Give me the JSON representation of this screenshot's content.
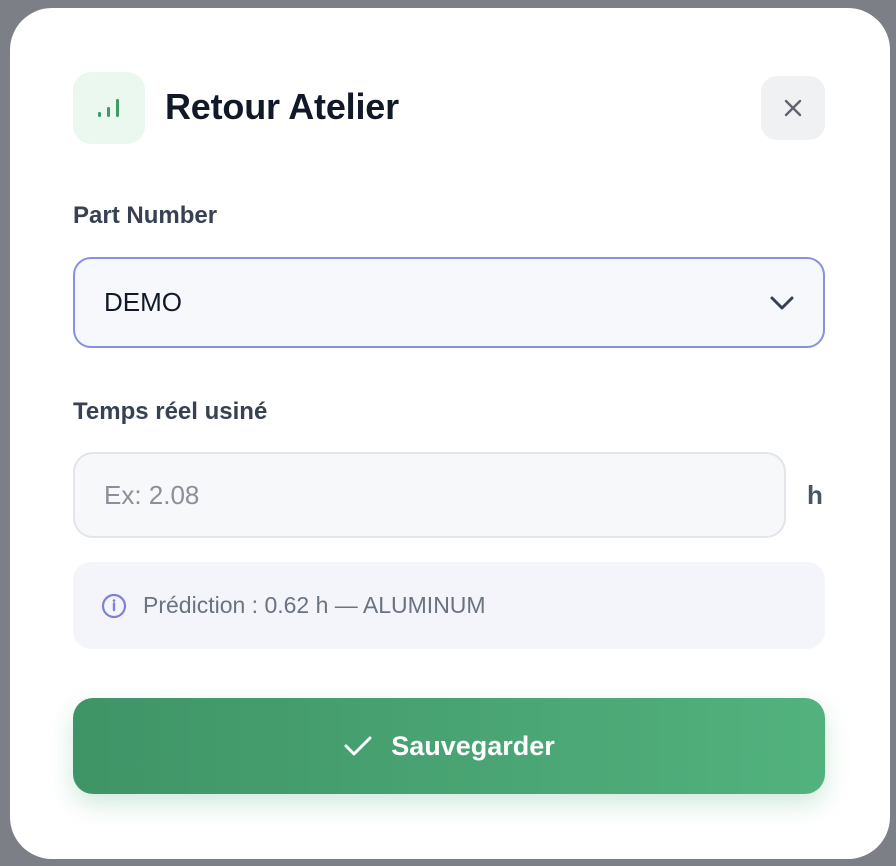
{
  "modal": {
    "title": "Retour Atelier",
    "header_icon": "bar-chart-icon",
    "close_icon": "close-icon"
  },
  "part_number": {
    "label": "Part Number",
    "selected": "DEMO",
    "dropdown_icon": "chevron-down-icon"
  },
  "temps": {
    "label": "Temps réel usiné",
    "placeholder": "Ex: 2.08",
    "value": "",
    "unit": "h"
  },
  "prediction": {
    "icon": "info-icon",
    "text": "Prédiction : 0.62 h — ALUMINUM"
  },
  "save": {
    "label": "Sauvegarder",
    "icon": "check-icon"
  },
  "colors": {
    "accent_green": "#4caf78",
    "select_border": "#8a8fe0",
    "title": "#111827"
  }
}
